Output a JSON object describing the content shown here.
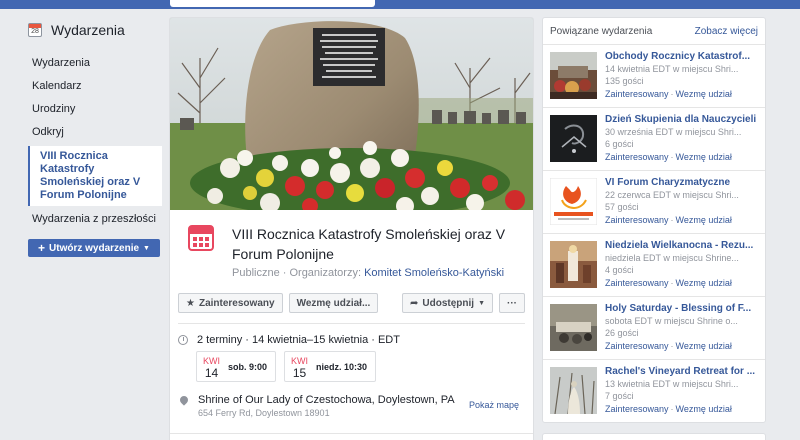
{
  "leftnav": {
    "title": "Wydarzenia",
    "calendar_day": "28",
    "items": [
      {
        "label": "Wydarzenia"
      },
      {
        "label": "Kalendarz"
      },
      {
        "label": "Urodziny"
      },
      {
        "label": "Odkryj"
      },
      {
        "label": "VIII Rocznica Katastrofy Smoleńskiej oraz V Forum Polonijne"
      },
      {
        "label": "Wydarzenia z przeszłości"
      }
    ],
    "create_label": "Utwórz wydarzenie",
    "create_plus": "+",
    "create_caret": "▼"
  },
  "event": {
    "title": "VIII Rocznica Katastrofy Smoleńskiej oraz V Forum Polonijne",
    "meta_prefix": "Publiczne · Organizatorzy:",
    "organizer": "Komitet Smoleńsko-Katyński",
    "actions": {
      "interested": "Zainteresowany",
      "going": "Wezmę udział...",
      "share": "Udostępnij",
      "more": "···",
      "star": "★",
      "share_icon": "➦",
      "caret": "▼"
    },
    "dates_summary": "2 terminy · 14 kwietnia–15 kwietnia · EDT",
    "dates": [
      {
        "month": "KWI",
        "day": "14",
        "time": "sob. 9:00"
      },
      {
        "month": "KWI",
        "day": "15",
        "time": "niedz. 10:30"
      }
    ],
    "location_name": "Shrine of Our Lady of Czestochowa, Doylestown, PA",
    "location_address": "654 Ferry Rd, Doylestown 18901",
    "map_link": "Pokaż mapę"
  },
  "related": {
    "heading": "Powiązane wydarzenia",
    "see_more": "Zobacz więcej",
    "interested": "Zainteresowany",
    "going": "Wezmę udział",
    "sep": "·",
    "items": [
      {
        "title": "Obchody Rocznicy Katastrof...",
        "when": "14 kwietnia EDT w miejscu Shri...",
        "count": "135 gości"
      },
      {
        "title": "Dzień Skupienia dla Nauczycieli",
        "when": "30 września EDT w miejscu Shri...",
        "count": "6 gości"
      },
      {
        "title": "VI Forum Charyzmatyczne",
        "when": "22 czerwca EDT w miejscu Shri...",
        "count": "57 gości"
      },
      {
        "title": "Niedziela Wielkanocna - Rezu...",
        "when": "niedziela EDT w miejscu Shrine...",
        "count": "4 gości"
      },
      {
        "title": "Holy Saturday - Blessing of F...",
        "when": "sobota EDT w miejscu Shrine o...",
        "count": "26 gości"
      },
      {
        "title": "Rachel's Vineyard Retreat for ...",
        "when": "13 kwietnia EDT w miejscu Shri...",
        "count": "7 gości"
      }
    ]
  },
  "colors": {
    "brand": "#4267b2",
    "link": "#365899",
    "calendar_red": "#e8475f"
  }
}
